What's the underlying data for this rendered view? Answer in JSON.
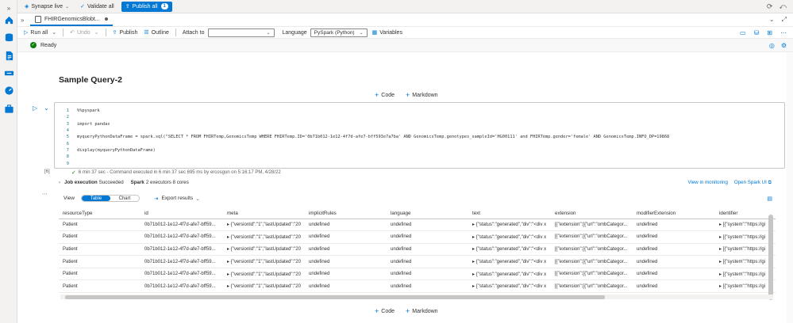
{
  "topbar": {
    "mode": "Synapse live",
    "validate_all": "Validate all",
    "publish_all": "Publish all",
    "publish_count": "1"
  },
  "tab": {
    "name": "FHIRGenomicsBlobt..."
  },
  "toolbar": {
    "run_all": "Run all",
    "undo": "Undo",
    "publish": "Publish",
    "outline": "Outline",
    "attach_to_label": "Attach to",
    "attach_to_value": "",
    "language_label": "Language",
    "language_value": "PySpark (Python)",
    "variables": "Variables"
  },
  "status": {
    "text": "Ready"
  },
  "markdown": {
    "title": "Sample Query-2"
  },
  "adder": {
    "code": "Code",
    "markdown": "Markdown"
  },
  "cell": {
    "exec_count": "[6]",
    "lines": [
      {
        "n": "1",
        "t": "%%pyspark"
      },
      {
        "n": "2",
        "t": ""
      },
      {
        "n": "3",
        "t": "import pandas"
      },
      {
        "n": "4",
        "t": ""
      },
      {
        "n": "5",
        "t": "myqueryPythonDataFrame = spark.sql(\"SELECT * FROM FHIRTemp,GenomicsTemp WHERE FHIRTemp.ID='0b71b012-1e12-4f7d-afe7-bff593e7a7ba' AND GenomicsTemp.genotypes_sampleId='HG00111' and FHIRTemp.gender='female' AND GenomicsTemp.INFO_DP=19868"
      },
      {
        "n": "6",
        "t": ""
      },
      {
        "n": "7",
        "t": "display(myqueryPythonDataFrame)"
      },
      {
        "n": "8",
        "t": ""
      },
      {
        "n": "9",
        "t": ""
      }
    ],
    "exec_info": "6 min 37 sec - Command executed in 6 min 37 sec 695 ms by ercosgun on 5:16:17 PM, 4/28/22"
  },
  "job": {
    "label": "Job execution",
    "status": "Succeeded",
    "spark_label": "Spark",
    "spark_info": "2 executors 8 cores",
    "view_monitoring": "View in monitoring",
    "open_spark_ui": "Open Spark UI"
  },
  "results": {
    "view_label": "View",
    "table_toggle": "Table",
    "chart_toggle": "Chart",
    "export": "Export results",
    "columns": [
      "resourceType",
      "id",
      "meta",
      "implicitRules",
      "language",
      "text",
      "extension",
      "modifierExtension",
      "identifier"
    ],
    "rows": [
      [
        "Patient",
        "0b71b012-1e12-4f7d-afe7-bff59...",
        "▸ {\"versionId\":\"1\",\"lastUpdated\":\"20",
        "undefined",
        "undefined",
        "▸ {\"status\":\"generated\",\"div\":\"<div x",
        "[{\"extension\":[{\"url\":\"ombCategor...",
        "undefined",
        "▸ [{\"system\":\"https://gi"
      ],
      [
        "Patient",
        "0b71b012-1e12-4f7d-afe7-bff59...",
        "▸ {\"versionId\":\"1\",\"lastUpdated\":\"20",
        "undefined",
        "undefined",
        "▸ {\"status\":\"generated\",\"div\":\"<div x",
        "[{\"extension\":[{\"url\":\"ombCategor...",
        "undefined",
        "▸ [{\"system\":\"https://gi"
      ],
      [
        "Patient",
        "0b71b012-1e12-4f7d-afe7-bff59...",
        "▸ {\"versionId\":\"1\",\"lastUpdated\":\"20",
        "undefined",
        "undefined",
        "▸ {\"status\":\"generated\",\"div\":\"<div x",
        "[{\"extension\":[{\"url\":\"ombCategor...",
        "undefined",
        "▸ [{\"system\":\"https://gi"
      ],
      [
        "Patient",
        "0b71b012-1e12-4f7d-afe7-bff59...",
        "▸ {\"versionId\":\"1\",\"lastUpdated\":\"20",
        "undefined",
        "undefined",
        "▸ {\"status\":\"generated\",\"div\":\"<div x",
        "[{\"extension\":[{\"url\":\"ombCategor...",
        "undefined",
        "▸ [{\"system\":\"https://gi"
      ],
      [
        "Patient",
        "0b71b012-1e12-4f7d-afe7-bff59...",
        "▸ {\"versionId\":\"1\",\"lastUpdated\":\"20",
        "undefined",
        "undefined",
        "▸ {\"status\":\"generated\",\"div\":\"<div x",
        "[{\"extension\":[{\"url\":\"ombCategor...",
        "undefined",
        "▸ [{\"system\":\"https://gi"
      ],
      [
        "Patient",
        "0b71b012-1e12-4f7d-afe7-bff59...",
        "▸ {\"versionId\":\"1\",\"lastUpdated\":\"20",
        "undefined",
        "undefined",
        "▸ {\"status\":\"generated\",\"div\":\"<div x",
        "[{\"extension\":[{\"url\":\"ombCategor...",
        "undefined",
        "▸ [{\"system\":\"https://gi"
      ]
    ]
  },
  "colors": {
    "accent": "#0078d4",
    "success": "#107c10"
  }
}
